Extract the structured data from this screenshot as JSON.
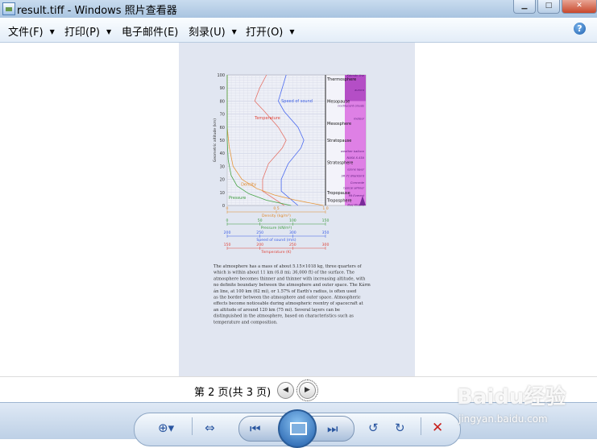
{
  "window": {
    "title": "result.tiff - Windows 照片查看器",
    "buttons": [
      "▁",
      "□",
      "✕"
    ]
  },
  "menu": {
    "items": [
      {
        "label": "文件(F)",
        "has_arrow": true
      },
      {
        "label": "打印(P)",
        "has_arrow": true
      },
      {
        "label": "电子邮件(E)",
        "has_arrow": false
      },
      {
        "label": "刻录(U)",
        "has_arrow": true
      },
      {
        "label": "打开(O)",
        "has_arrow": true
      }
    ],
    "help": "?"
  },
  "document": {
    "chart": {
      "y_axis_label": "Geometric altitude (km)",
      "y_ticks": [
        "0",
        "10",
        "20",
        "30",
        "40",
        "50",
        "60",
        "70",
        "80",
        "90",
        "100"
      ],
      "curve_labels": {
        "speed": "Speed of sound",
        "temperature": "Temperature",
        "density": "Density",
        "pressure": "Pressure"
      },
      "layers": [
        {
          "name": "Thermosphere",
          "alt": 97
        },
        {
          "name": "Mesopause",
          "alt": 80
        },
        {
          "name": "Mesosphere",
          "alt": 63
        },
        {
          "name": "Stratopause",
          "alt": 50
        },
        {
          "name": "Stratosphere",
          "alt": 33
        },
        {
          "name": "Tropopause",
          "alt": 10
        },
        {
          "name": "Troposphere",
          "alt": 4
        }
      ],
      "annotations": [
        {
          "text": "Kármán line",
          "alt": 100
        },
        {
          "text": "aurora",
          "alt": 89
        },
        {
          "text": "noctilucent clouds",
          "alt": 77
        },
        {
          "text": "meteor",
          "alt": 67
        },
        {
          "text": "weather balloon",
          "alt": 42
        },
        {
          "text": "NASA X-43A",
          "alt": 37
        },
        {
          "text": "ozone layer",
          "alt": 28
        },
        {
          "text": "SR-71 Blackbird",
          "alt": 23
        },
        {
          "text": "Concorde",
          "alt": 18
        },
        {
          "text": "typical airliner",
          "alt": 14
        },
        {
          "text": "Mt Everest",
          "alt": 8
        },
        {
          "text": "Burj Khalifa",
          "alt": 1
        }
      ],
      "axes": [
        {
          "label": "Density (kg/m³)",
          "ticks": [
            "0",
            "0.5",
            "1.0"
          ],
          "color": "#e08a2c"
        },
        {
          "label": "Pressure (kN/m²)",
          "ticks": [
            "0",
            "50",
            "100",
            "150"
          ],
          "color": "#3c9a3c"
        },
        {
          "label": "Speed of sound (m/s)",
          "ticks": [
            "200",
            "250",
            "300",
            "350"
          ],
          "color": "#3b5ee6"
        },
        {
          "label": "Temperature (K)",
          "ticks": [
            "150",
            "200",
            "250",
            "300"
          ],
          "color": "#e0453a"
        }
      ]
    },
    "paragraph": [
      "The atmosphere has a mass of about 5.15×1018 kg, three quarters of",
      "which is within about 11 km (6.8 mi; 36,000 ft) of the surface. The",
      "atmosphere becomes thinner and thinner with increasing altitude, with",
      "no definite boundary between the atmosphere and outer space. The Kárm",
      "án line, at 100 km (62 mi), or 1.57% of Earth's radius, is often used",
      "as the border between the atmosphere and outer space. Atmospheric",
      "effects become noticeable during atmospheric reentry of spacecraft at",
      "an altitude of around 120 km (75 mi). Several layers can be",
      "distinguished in the atmosphere, based on characteristics such as",
      "temperature and composition."
    ]
  },
  "navigation": {
    "page_indicator": "第 2 页(共 3 页)",
    "prev": "◀",
    "next": "▶"
  },
  "toolbar": {
    "zoom": "⊕▾",
    "fit": "⇔",
    "prev": "⏮",
    "next": "⏭",
    "rotate_ccw": "↺",
    "rotate_cw": "↻",
    "delete": "✕"
  },
  "watermark": {
    "logo": "Baidu经验",
    "url": "jingyan.baidu.com"
  }
}
